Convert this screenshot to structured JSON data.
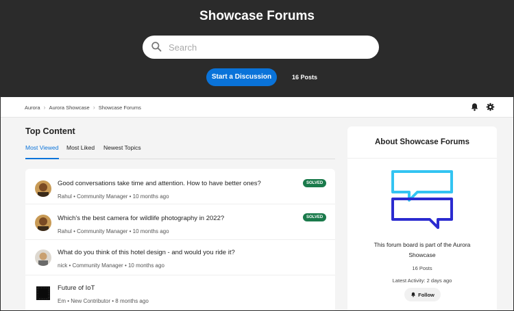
{
  "header": {
    "title": "Showcase Forums",
    "search_placeholder": "Search",
    "start_discussion_label": "Start a Discussion",
    "post_count": "16 Posts"
  },
  "breadcrumb": [
    "Aurora",
    "Aurora Showcase",
    "Showcase Forums"
  ],
  "top_content": {
    "title": "Top Content",
    "tabs": [
      "Most Viewed",
      "Most Liked",
      "Newest Topics"
    ],
    "active_tab": "Most Viewed"
  },
  "posts": [
    {
      "title": "Good conversations take time and attention. How to have better ones?",
      "meta": "Rahul • Community Manager • 10 months ago",
      "badge": "SOLVED",
      "avatar": "photo-rahul"
    },
    {
      "title": "Which's the best camera for wildlife photography in 2022?",
      "meta": "Rahul • Community Manager • 10 months ago",
      "badge": "SOLVED",
      "avatar": "photo-rahul"
    },
    {
      "title": "What do you think of this hotel design - and would you ride it?",
      "meta": "nick • Community Manager • 10 months ago",
      "badge": "",
      "avatar": "photo-nick"
    },
    {
      "title": "Future of IoT",
      "meta": "Em • New Contributor • 8 months ago",
      "badge": "",
      "avatar": "dark-square"
    }
  ],
  "about": {
    "title": "About Showcase Forums",
    "description": "This forum board is part of the Aurora Showcase",
    "posts": "16 Posts",
    "latest_activity": "Latest Activity: 2 days ago",
    "follow_label": "Follow"
  },
  "icons": {
    "search": "search-icon",
    "bell": "bell-icon",
    "gear": "gear-icon",
    "chevron": "chevron-right-icon",
    "logo": "chat-bubbles-icon"
  },
  "colors": {
    "hero_bg": "#2b2b2b",
    "accent": "#0a73d9",
    "solved": "#1a7a4b",
    "logo_light": "#33c4f2",
    "logo_dark": "#2b2bd0"
  }
}
